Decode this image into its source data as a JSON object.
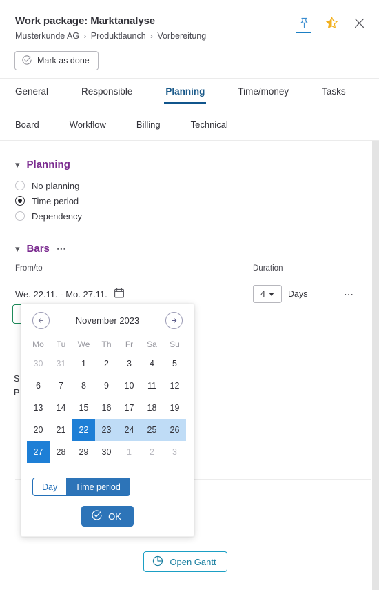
{
  "header": {
    "title": "Work package: Marktanalyse",
    "breadcrumb": [
      "Musterkunde AG",
      "Produktlaunch",
      "Vorbereitung"
    ],
    "breadcrumb_separator": "›",
    "mark_as_done": "Mark as done",
    "icons": [
      "pin-icon",
      "star-half-icon",
      "close-icon"
    ]
  },
  "tabs_primary": [
    {
      "label": "General",
      "active": false
    },
    {
      "label": "Responsible",
      "active": false
    },
    {
      "label": "Planning",
      "active": true
    },
    {
      "label": "Time/money",
      "active": false
    },
    {
      "label": "Tasks",
      "active": false
    }
  ],
  "tabs_secondary": [
    {
      "label": "Board"
    },
    {
      "label": "Workflow"
    },
    {
      "label": "Billing"
    },
    {
      "label": "Technical"
    }
  ],
  "planning_section": {
    "heading": "Planning",
    "options": [
      {
        "label": "No planning",
        "selected": false
      },
      {
        "label": "Time period",
        "selected": true
      },
      {
        "label": "Dependency",
        "selected": false
      }
    ]
  },
  "bars_section": {
    "heading": "Bars",
    "overflow_label": "⋯",
    "columns": {
      "from_to": "From/to",
      "duration": "Duration"
    },
    "row": {
      "from_to": "We. 22.11. - Mo. 27.11.",
      "duration_value": "4",
      "duration_unit": "Days",
      "row_menu": "⋯"
    },
    "obscured_labels": [
      "S",
      "P"
    ]
  },
  "gantt": {
    "label": "Open Gantt"
  },
  "calendar": {
    "month_label": "November 2023",
    "prev_label": "←",
    "next_label": "→",
    "weekdays": [
      "Mo",
      "Tu",
      "We",
      "Th",
      "Fr",
      "Sa",
      "Su"
    ],
    "weeks": [
      [
        {
          "d": "30",
          "state": "muted"
        },
        {
          "d": "31",
          "state": "muted"
        },
        {
          "d": "1",
          "state": "normal"
        },
        {
          "d": "2",
          "state": "normal"
        },
        {
          "d": "3",
          "state": "normal"
        },
        {
          "d": "4",
          "state": "normal"
        },
        {
          "d": "5",
          "state": "normal"
        }
      ],
      [
        {
          "d": "6",
          "state": "normal"
        },
        {
          "d": "7",
          "state": "normal"
        },
        {
          "d": "8",
          "state": "normal"
        },
        {
          "d": "9",
          "state": "normal"
        },
        {
          "d": "10",
          "state": "normal"
        },
        {
          "d": "11",
          "state": "normal"
        },
        {
          "d": "12",
          "state": "normal"
        }
      ],
      [
        {
          "d": "13",
          "state": "normal"
        },
        {
          "d": "14",
          "state": "normal"
        },
        {
          "d": "15",
          "state": "normal"
        },
        {
          "d": "16",
          "state": "normal"
        },
        {
          "d": "17",
          "state": "normal"
        },
        {
          "d": "18",
          "state": "normal"
        },
        {
          "d": "19",
          "state": "normal"
        }
      ],
      [
        {
          "d": "20",
          "state": "normal"
        },
        {
          "d": "21",
          "state": "normal"
        },
        {
          "d": "22",
          "state": "selected"
        },
        {
          "d": "23",
          "state": "inrange"
        },
        {
          "d": "24",
          "state": "inrange"
        },
        {
          "d": "25",
          "state": "inrange"
        },
        {
          "d": "26",
          "state": "inrange"
        }
      ],
      [
        {
          "d": "27",
          "state": "selected"
        },
        {
          "d": "28",
          "state": "normal"
        },
        {
          "d": "29",
          "state": "normal"
        },
        {
          "d": "30",
          "state": "normal"
        },
        {
          "d": "1",
          "state": "muted"
        },
        {
          "d": "2",
          "state": "muted"
        },
        {
          "d": "3",
          "state": "muted"
        }
      ]
    ],
    "mode_toggle": [
      {
        "label": "Day",
        "active": false
      },
      {
        "label": "Time period",
        "active": true
      }
    ],
    "ok_label": "OK"
  },
  "colors": {
    "accent_purple": "#7a2a8f",
    "tab_active_blue": "#10558c",
    "calendar_selected": "#1e7fd6",
    "calendar_range": "#bfdcf6",
    "button_blue": "#2d74b8",
    "gantt_teal": "#1b9fc4",
    "star_gold": "#f2b01e"
  }
}
